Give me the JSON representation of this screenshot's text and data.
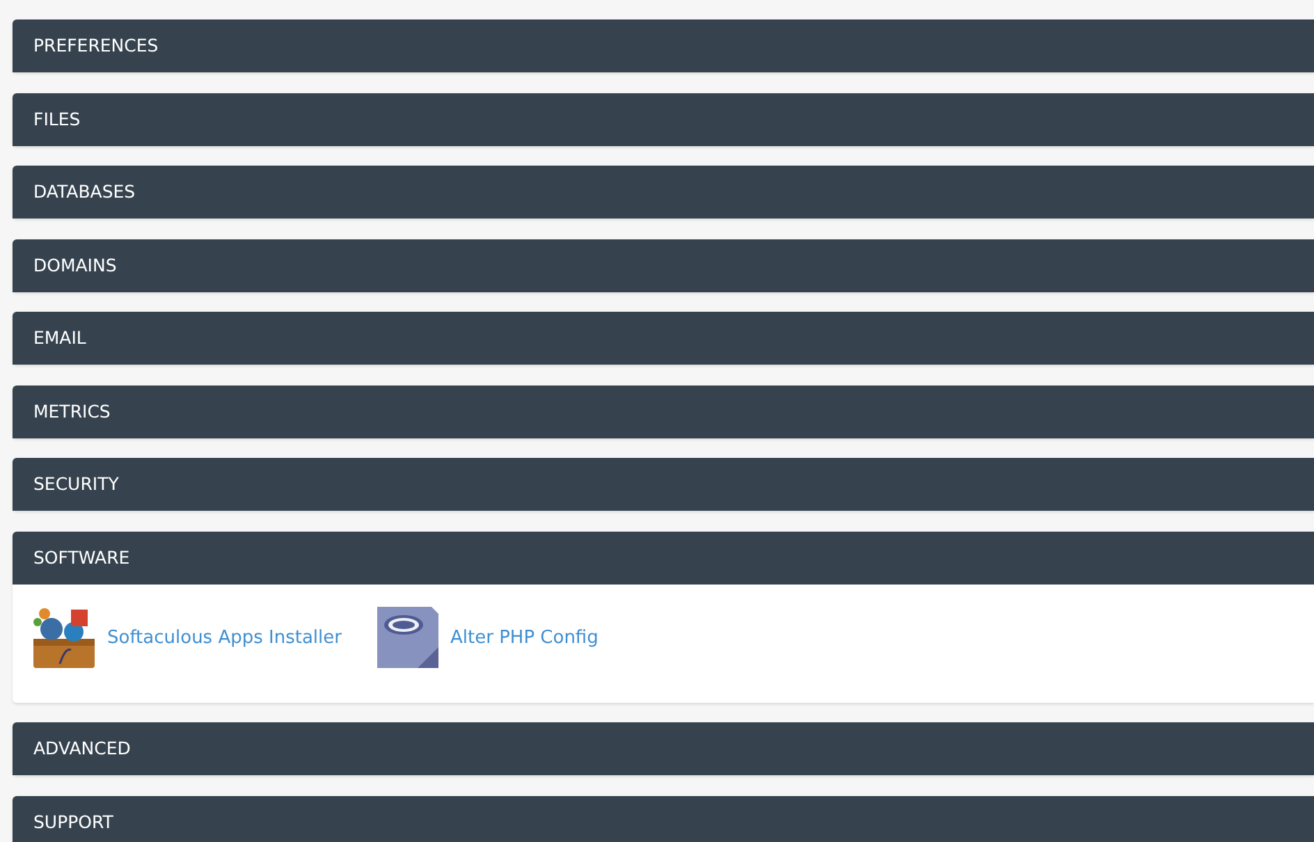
{
  "sections": [
    {
      "title": "PREFERENCES"
    },
    {
      "title": "FILES"
    },
    {
      "title": "DATABASES"
    },
    {
      "title": "DOMAINS"
    },
    {
      "title": "EMAIL"
    },
    {
      "title": "METRICS"
    },
    {
      "title": "SECURITY"
    },
    {
      "title": "SOFTWARE",
      "items": [
        {
          "label": "Softaculous Apps Installer",
          "kind": "softaculous"
        },
        {
          "label": "Alter PHP Config",
          "kind": "php"
        }
      ]
    },
    {
      "title": "ADVANCED"
    },
    {
      "title": "SUPPORT"
    }
  ]
}
